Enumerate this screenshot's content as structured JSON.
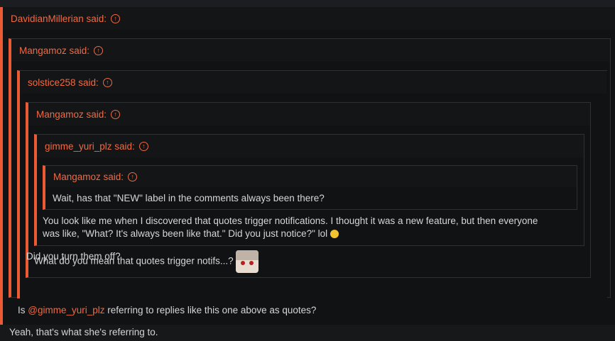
{
  "thread": {
    "level1": {
      "author_said": "DavidianMillerian said:",
      "reply": "Yeah, that's what she's referring to."
    },
    "level2": {
      "author_said": "Mangamoz said:",
      "reply_prefix": "Is ",
      "mention": "@gimme_yuri_plz",
      "reply_suffix": " referring to replies like this one above as quotes?"
    },
    "level3": {
      "author_said": "solstice258 said:",
      "reply": "Did you turn them off?"
    },
    "level4": {
      "author_said": "Mangamoz said:",
      "reply": "What do you mean that quotes trigger notifs...?"
    },
    "level5": {
      "author_said": "gimme_yuri_plz said:",
      "reply_line1": "You look like me when I discovered that quotes trigger notifications. I thought it was a new feature, but then everyone",
      "reply_line2": "was like, \"What? It's always been like that.\" Did you just notice?\" lol"
    },
    "level6": {
      "author_said": "Mangamoz said:",
      "reply": "Wait, has that \"NEW\" label in the comments always been there?"
    }
  },
  "icons": {
    "jump_to_post": "arrow-up-circle-icon",
    "avatar": "anime-avatar-icon",
    "emoji": "laughing-emoji-icon"
  },
  "colors": {
    "accent": "#ec5a33",
    "text": "#d6d6d6",
    "background": "#111214"
  }
}
